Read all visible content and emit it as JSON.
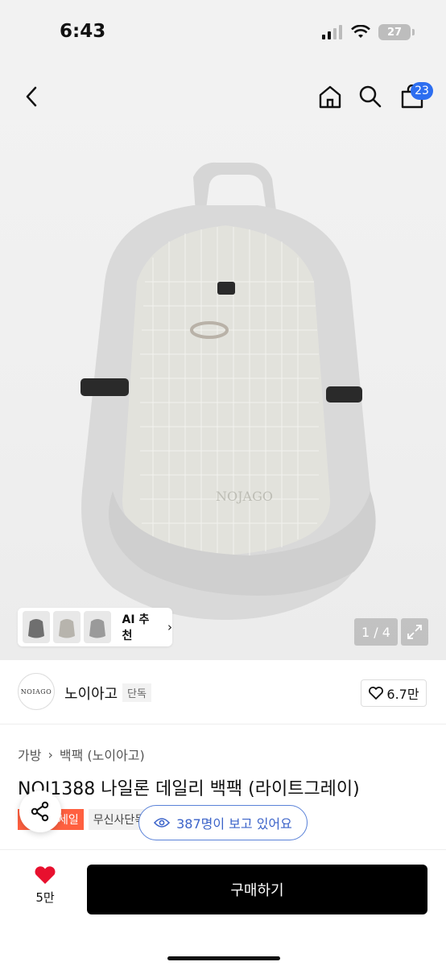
{
  "status": {
    "time": "6:43",
    "battery": "27"
  },
  "nav": {
    "cart_count": "23"
  },
  "gallery": {
    "ai_label": "AI 추천",
    "ai_chevron": "›",
    "counter": "1 / 4",
    "image_text": "NOJAGO"
  },
  "brand": {
    "logo_text": "NOIAGO",
    "name": "노이아고",
    "tag": "단독",
    "likes": "6.7만"
  },
  "product": {
    "breadcrumb": [
      "가방",
      "백팩 (노이아고)"
    ],
    "breadcrumb_sep": "›",
    "title": "NOJ1388 나일론 데일리 백팩 (라이트그레이)",
    "badges": {
      "sale": "세일",
      "exclusive": "무신사단독"
    }
  },
  "viewers": {
    "text": "387명이 보고 있어요"
  },
  "bottom": {
    "wish_count": "5만",
    "buy_label": "구매하기"
  },
  "colors": {
    "accent_blue": "#2d6ef0",
    "heart_red": "#e8102e",
    "sale_orange": "#ff6040"
  }
}
